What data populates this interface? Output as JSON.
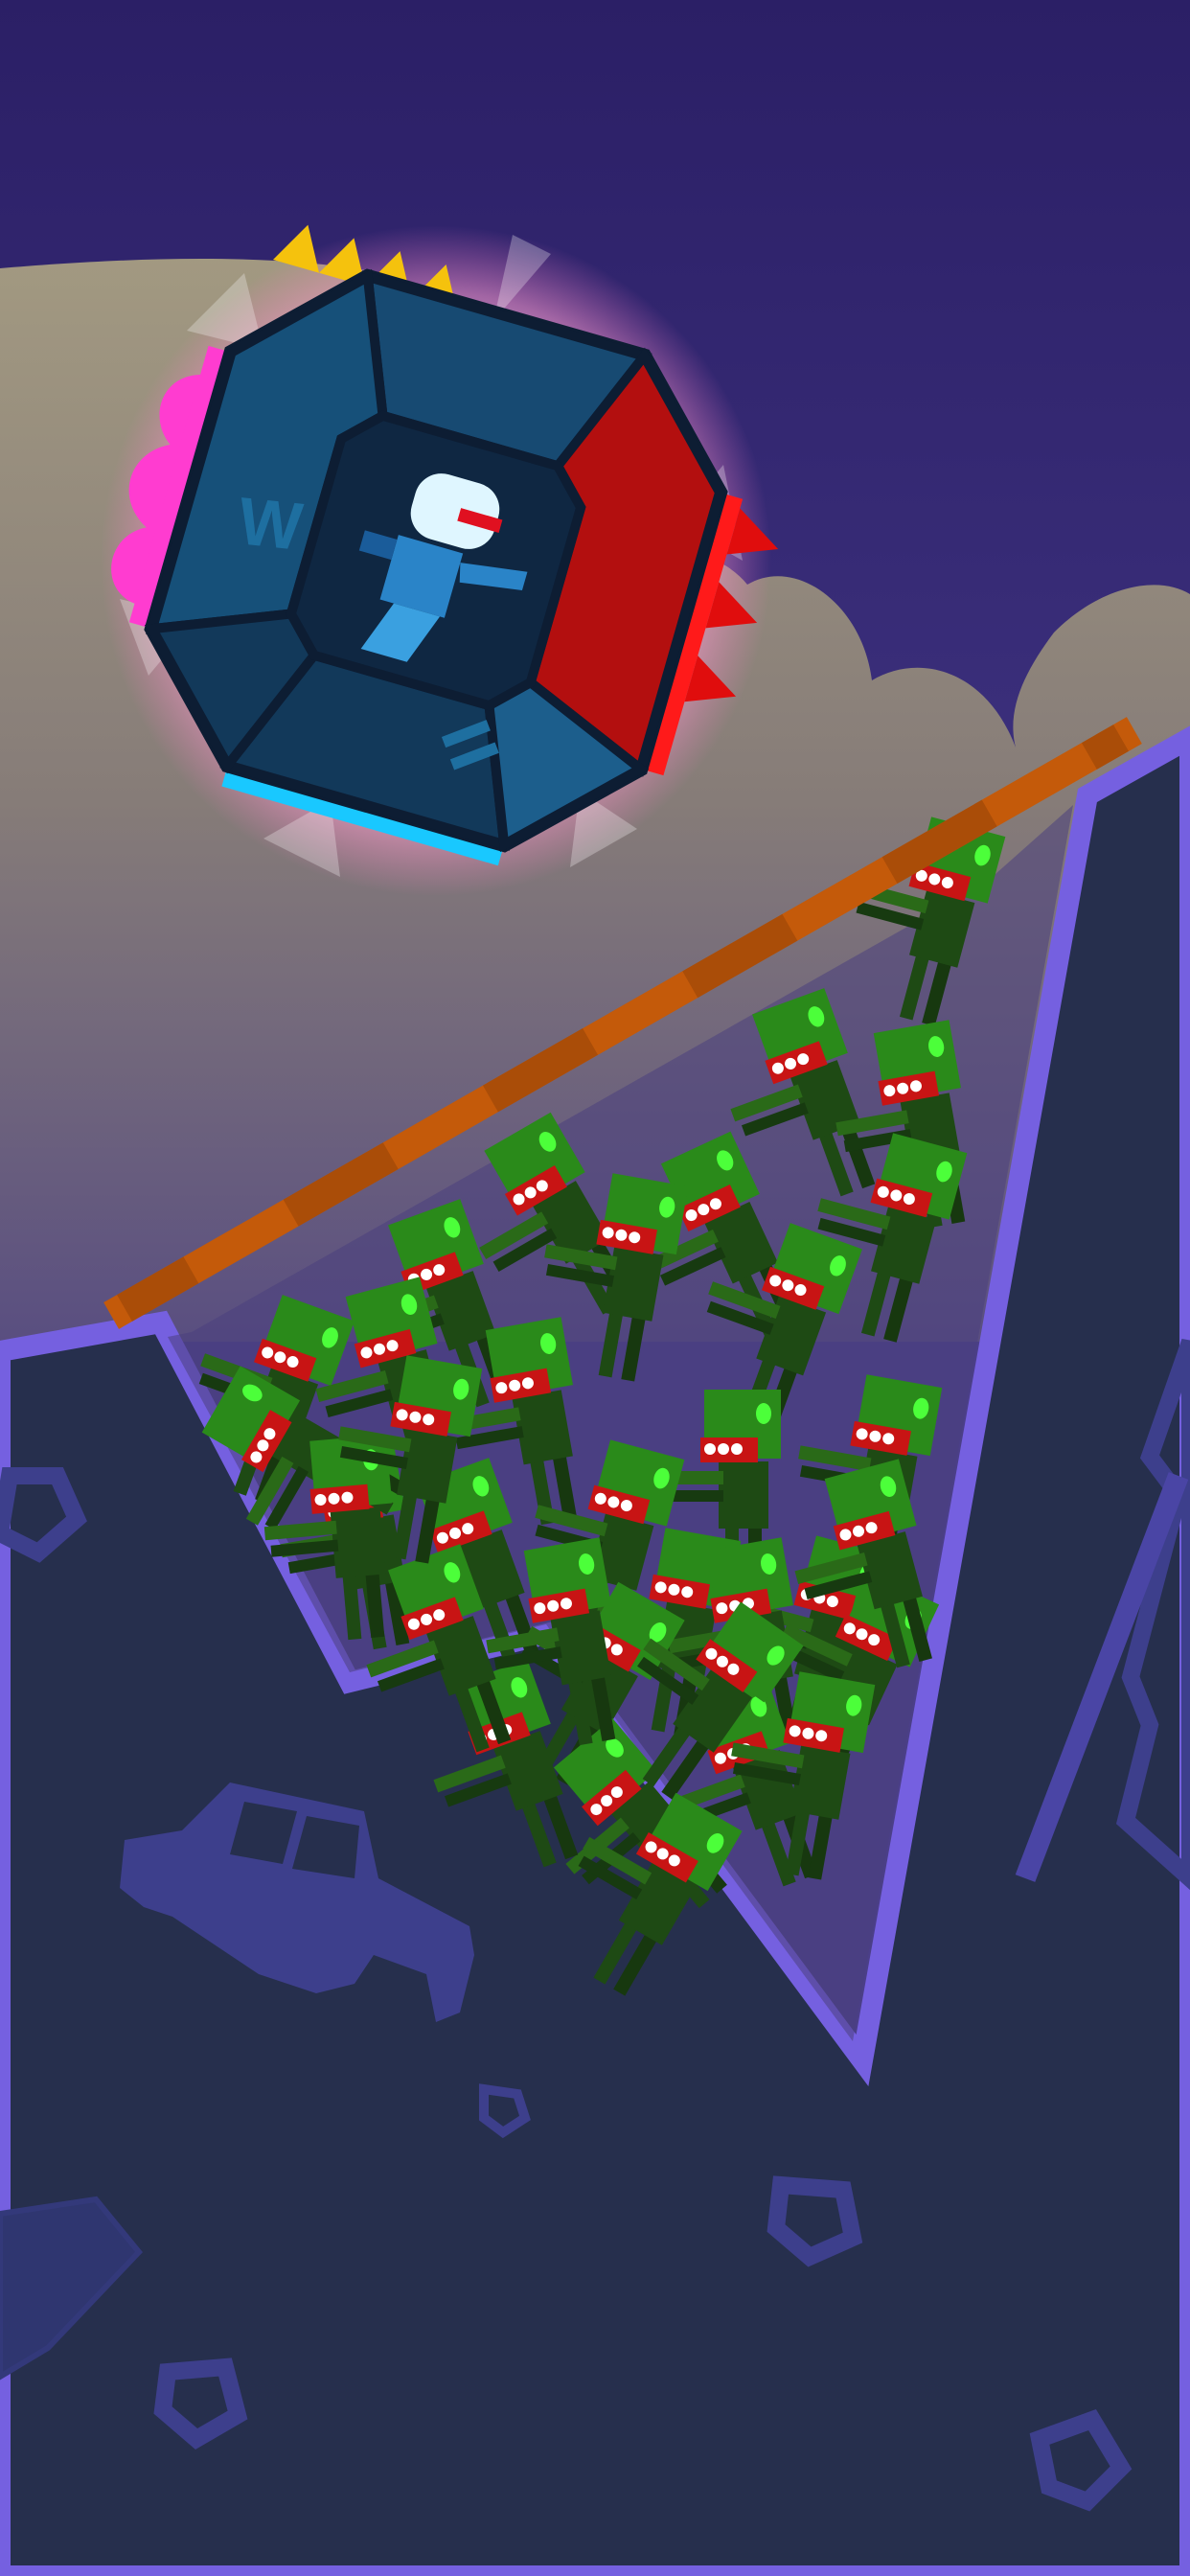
{
  "scene": {
    "type": "physics-puzzle-game",
    "description_objects": [
      "vehicle-cube",
      "robot-driver",
      "zombie-horde",
      "ramp-plank",
      "pit-terrain"
    ],
    "colors": {
      "sky_top": "#2b1f66",
      "sky_bottom": "#4b3f88",
      "dust_cloud": "#9c9379",
      "ground": "#262f4d",
      "ground_outline": "#7560e0",
      "plank": "#c45a0a",
      "zombie_skin": "#2a8a1a",
      "zombie_body": "#1e4a14",
      "zombie_mouth": "#c81414",
      "cube_body": "#15496e",
      "cube_glow": "#ff9ad0",
      "side_pink": "#ff3cd0",
      "side_red": "#ff1a1a",
      "side_cyan": "#19c8ff",
      "spikes_yellow": "#f5c20d",
      "debris": "#3d3f8c"
    },
    "zombie_count": 34
  }
}
